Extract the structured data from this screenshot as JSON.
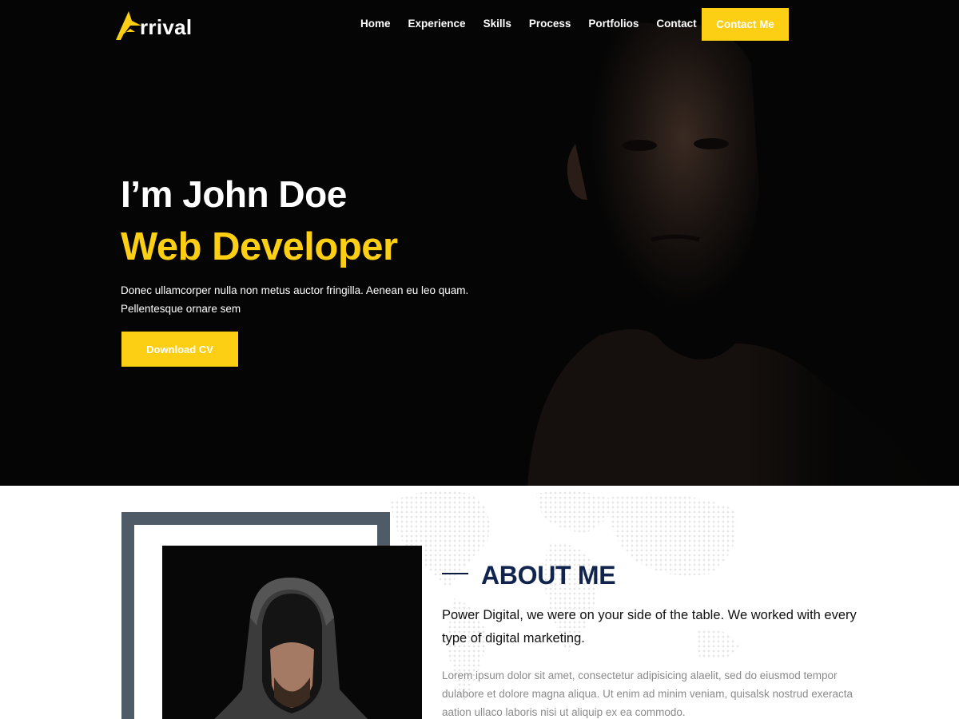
{
  "brand": {
    "name": "rrival",
    "colors": {
      "accent": "#fccf14",
      "navy": "#10244e",
      "frame": "#505b68"
    }
  },
  "nav": {
    "items": [
      {
        "label": "Home"
      },
      {
        "label": "Experience"
      },
      {
        "label": "Skills"
      },
      {
        "label": "Process"
      },
      {
        "label": "Portfolios"
      },
      {
        "label": "Contact"
      }
    ],
    "cta_label": "Contact Me"
  },
  "hero": {
    "title": "I’m John Doe",
    "subtitle": "Web Developer",
    "description": "Donec ullamcorper nulla non metus auctor fringilla. Aenean eu leo quam. Pellentesque ornare sem",
    "button_label": "Download CV"
  },
  "about": {
    "title": "ABOUT ME",
    "lead": "Power Digital, we were on your side of the table. We worked with every type of digital marketing.",
    "body": "Lorem ipsum dolor sit amet, consectetur adipisicing alaelit, sed do eiusmod tempor dulabore et dolore magna aliqua. Ut enim ad minim veniam, quisalsk nostrud exeracta aation ullaco laboris nisi ut aliquip ex ea commodo."
  },
  "icons": {
    "logo": "arrow-a-logo-icon",
    "map": "world-map-dots"
  }
}
